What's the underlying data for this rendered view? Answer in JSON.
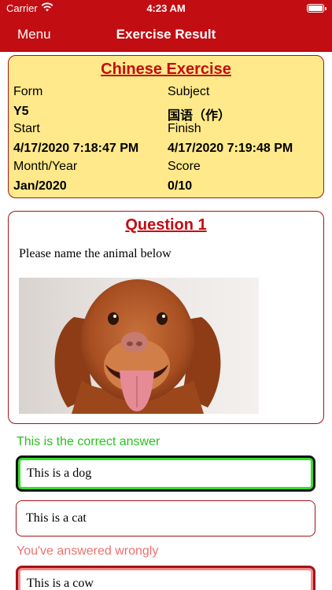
{
  "status_bar": {
    "carrier": "Carrier",
    "time": "4:23 AM"
  },
  "nav": {
    "menu_label": "Menu",
    "title": "Exercise Result"
  },
  "exercise": {
    "title": "Chinese Exercise",
    "form_label": "Form",
    "form_value": "Y5",
    "subject_label": "Subject",
    "subject_value": "国语（作）",
    "start_label": "Start",
    "start_value": "4/17/2020 7:18:47 PM",
    "finish_label": "Finish",
    "finish_value": "4/17/2020 7:19:48 PM",
    "month_label": "Month/Year",
    "month_value": "Jan/2020",
    "score_label": "Score",
    "score_value": "0/10"
  },
  "question": {
    "title": "Question 1",
    "text": "Please name the animal below",
    "image_subject": "dog photo"
  },
  "answers": {
    "correct_note": "This is the correct answer",
    "wrong_note": "You've answered wrongly",
    "options": [
      "This is a dog",
      "This is a cat",
      "This is a cow"
    ]
  },
  "colors": {
    "brand_red": "#c20d12",
    "card_yellow": "#ffe98a",
    "correct_green": "#33e02a",
    "wrong_red": "#ef6f6f"
  }
}
